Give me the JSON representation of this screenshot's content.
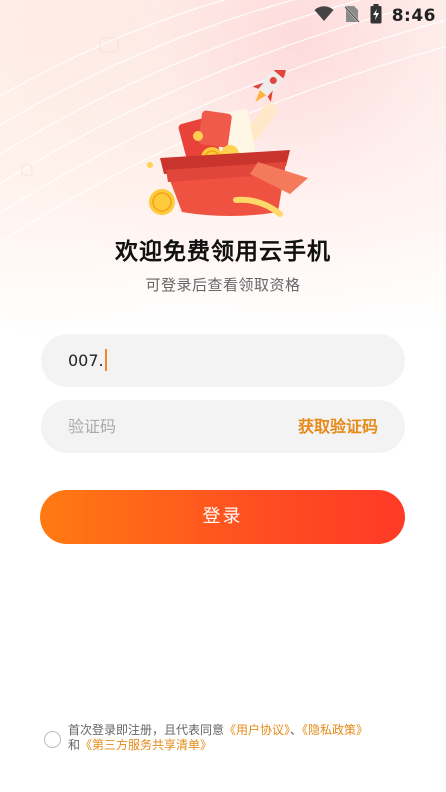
{
  "status_bar": {
    "time": "8:46",
    "icons": [
      "wifi-icon",
      "no-sim-icon",
      "battery-charging-icon"
    ]
  },
  "hero": {
    "title": "欢迎免费领用云手机",
    "subtitle": "可登录后查看领取资格",
    "illustration": "gift-box-rocket-coins-illustration"
  },
  "form": {
    "phone_value": "007.",
    "code_placeholder": "验证码",
    "get_code_label": "获取验证码",
    "login_label": "登录"
  },
  "agreement": {
    "prefix": "首次登录即注册，且代表同意",
    "user_agreement": "《用户协议》",
    "separator": "、",
    "privacy_policy": "《隐私政策》",
    "and": "和",
    "third_party_list": "《第三方服务共享清单》"
  },
  "colors": {
    "accent": "#e68a1a",
    "button_start": "#ff7a12",
    "button_end": "#ff3a26",
    "field_bg": "#f3f3f3"
  }
}
